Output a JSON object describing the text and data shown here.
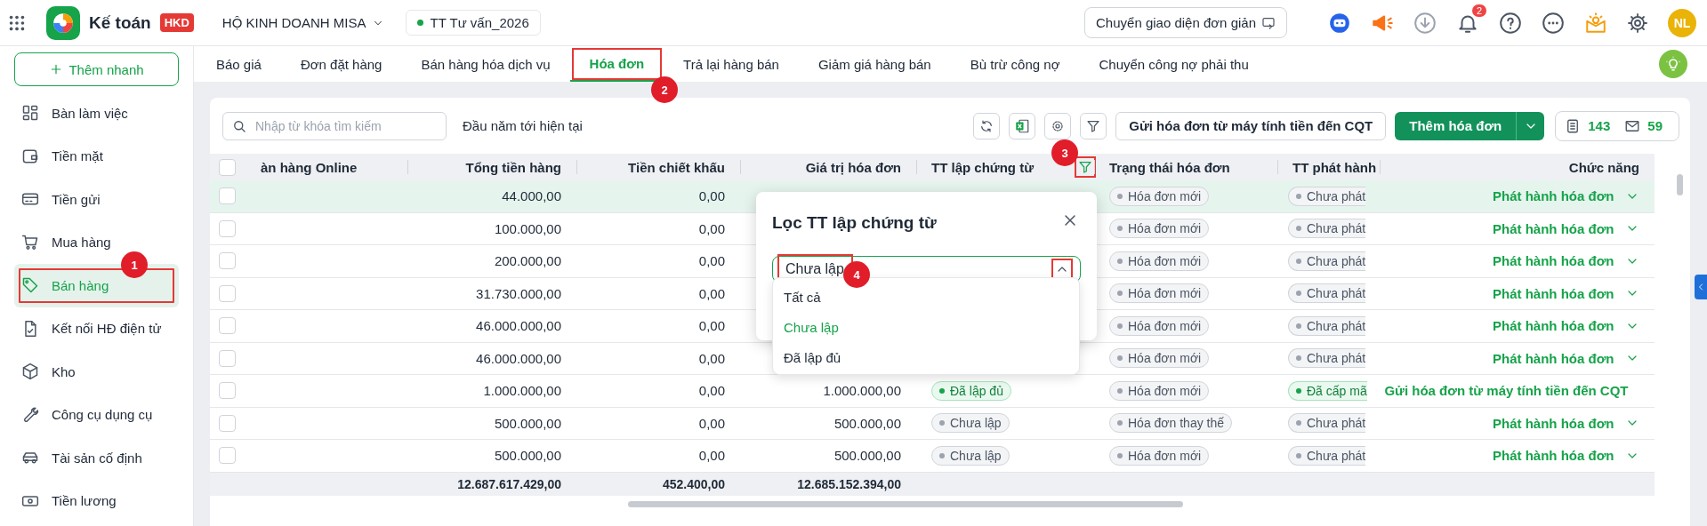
{
  "header": {
    "app_name": "Kế toán",
    "edition": "HKD",
    "company": "HỘ KINH DOANH MISA",
    "branch": "TT Tư vấn_2026",
    "switch_button": "Chuyển giao diện đơn giản",
    "notification_count": "2",
    "avatar": "NL"
  },
  "sidebar": {
    "quick_add": "Thêm nhanh",
    "items": [
      {
        "label": "Bàn làm việc",
        "kind": "dashboard",
        "selected": false
      },
      {
        "label": "Tiền mặt",
        "kind": "wallet",
        "selected": false
      },
      {
        "label": "Tiền gửi",
        "kind": "card",
        "selected": false
      },
      {
        "label": "Mua hàng",
        "kind": "cart",
        "selected": false
      },
      {
        "label": "Bán hàng",
        "kind": "tag",
        "selected": true,
        "callout": "1"
      },
      {
        "label": "Kết nối HĐ điện tử",
        "kind": "document",
        "selected": false
      },
      {
        "label": "Kho",
        "kind": "box",
        "selected": false
      },
      {
        "label": "Công cụ dụng cụ",
        "kind": "wrench",
        "selected": false
      },
      {
        "label": "Tài sản cố định",
        "kind": "car",
        "selected": false
      },
      {
        "label": "Tiền lương",
        "kind": "money",
        "selected": false
      }
    ]
  },
  "tabs": [
    {
      "label": "Báo giá",
      "selected": false
    },
    {
      "label": "Đơn đặt hàng",
      "selected": false
    },
    {
      "label": "Bán hàng hóa dịch vụ",
      "selected": false
    },
    {
      "label": "Hóa đơn",
      "selected": true,
      "callout": "2"
    },
    {
      "label": "Trả lại hàng bán",
      "selected": false
    },
    {
      "label": "Giảm giá hàng bán",
      "selected": false
    },
    {
      "label": "Bù trừ công nợ",
      "selected": false
    },
    {
      "label": "Chuyển công nợ phải thu",
      "selected": false
    }
  ],
  "toolbar": {
    "search": {
      "placeholder": "Nhập từ khóa tìm kiếm"
    },
    "period": "Đầu năm tới hiện tại",
    "send_button": "Gửi hóa đơn từ máy tính tiền đến CQT",
    "add_button": "Thêm hóa đơn",
    "invoice_count": "143",
    "email_count": "59"
  },
  "table": {
    "columns": [
      {
        "label": "àn hàng Online",
        "kind": "text"
      },
      {
        "label": "Tổng tiền hàng",
        "kind": "amount"
      },
      {
        "label": "Tiền chiết khấu",
        "kind": "amount"
      },
      {
        "label": "Giá trị hóa đơn",
        "kind": "amount"
      },
      {
        "label": "TT lập chứng từ",
        "kind": "text",
        "filtered": true,
        "callout": "3"
      },
      {
        "label": "Trạng thái hóa đơn",
        "kind": "text"
      },
      {
        "label": "TT phát hành",
        "kind": "text"
      },
      {
        "label": "Chức năng",
        "kind": "amount"
      }
    ],
    "select_all": {
      "checked": false
    },
    "rows": [
      {
        "selected": true,
        "checked": false,
        "total_goods": "44.000,00",
        "discount": "0,00",
        "invoice_status": "Hóa đơn mới",
        "issue_status": {
          "label": "Chưa phát",
          "kind": "pending"
        },
        "action": "Phát hành hóa đơn"
      },
      {
        "selected": false,
        "checked": false,
        "total_goods": "100.000,00",
        "discount": "0,00",
        "invoice_status": "Hóa đơn mới",
        "issue_status": {
          "label": "Chưa phát",
          "kind": "pending"
        },
        "action": "Phát hành hóa đơn"
      },
      {
        "selected": false,
        "checked": false,
        "total_goods": "200.000,00",
        "discount": "0,00",
        "invoice_status": "Hóa đơn mới",
        "issue_status": {
          "label": "Chưa phát",
          "kind": "pending"
        },
        "action": "Phát hành hóa đơn"
      },
      {
        "selected": false,
        "checked": false,
        "total_goods": "31.730.000,00",
        "discount": "0,00",
        "invoice_status": "Hóa đơn mới",
        "issue_status": {
          "label": "Chưa phát",
          "kind": "pending"
        },
        "action": "Phát hành hóa đơn"
      },
      {
        "selected": false,
        "checked": false,
        "total_goods": "46.000.000,00",
        "discount": "0,00",
        "invoice_status": "Hóa đơn mới",
        "issue_status": {
          "label": "Chưa phát",
          "kind": "pending"
        },
        "action": "Phát hành hóa đơn"
      },
      {
        "selected": false,
        "checked": false,
        "total_goods": "46.000.000,00",
        "discount": "0,00",
        "invoice_status": "Hóa đơn mới",
        "issue_status": {
          "label": "Chưa phát",
          "kind": "pending"
        },
        "action": "Phát hành hóa đơn"
      },
      {
        "selected": false,
        "checked": false,
        "total_goods": "1.000.000,00",
        "discount": "0,00",
        "invoice_value": "1.000.000,00",
        "doc_status": {
          "label": "Đã lập đủ",
          "kind": "done"
        },
        "invoice_status": "Hóa đơn mới",
        "issue_status": {
          "label": "Đã cấp mã",
          "kind": "done"
        },
        "action": "Gửi hóa đơn từ máy tính tiền đến CQT"
      },
      {
        "selected": false,
        "checked": false,
        "total_goods": "500.000,00",
        "discount": "0,00",
        "invoice_value": "500.000,00",
        "doc_status": {
          "label": "Chưa lập",
          "kind": "pending"
        },
        "invoice_status": "Hóa đơn thay thế",
        "issue_status": {
          "label": "Chưa phát",
          "kind": "pending"
        },
        "action": "Phát hành hóa đơn"
      },
      {
        "selected": false,
        "checked": false,
        "total_goods": "500.000,00",
        "discount": "0,00",
        "invoice_value": "500.000,00",
        "doc_status": {
          "label": "Chưa lập",
          "kind": "pending"
        },
        "invoice_status": "Hóa đơn mới",
        "issue_status": {
          "label": "Chưa phát",
          "kind": "pending"
        },
        "action": "Phát hành hóa đơn"
      }
    ],
    "totals": {
      "total_goods": "12.687.617.429,00",
      "discount": "452.400,00",
      "invoice_value": "12.685.152.394,00"
    }
  },
  "filter_popup": {
    "title": "Lọc TT lập chứng từ",
    "value": "Chưa lập",
    "expanded": true,
    "callout": "4",
    "options": [
      {
        "label": "Tất cả",
        "selected": false
      },
      {
        "label": "Chưa lập",
        "selected": true
      },
      {
        "label": "Đã lập đủ",
        "selected": false
      }
    ]
  }
}
